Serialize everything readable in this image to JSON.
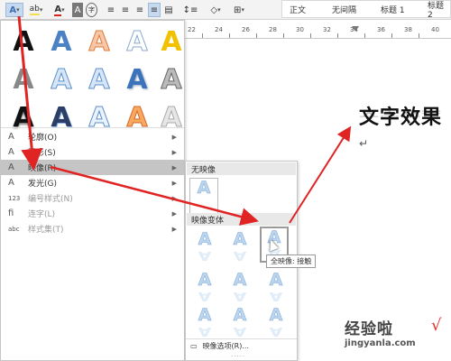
{
  "toolbar": {
    "text_effects_icon": "A",
    "highlight_icon": "ab",
    "font_color_icon": "A",
    "char_shading_icon": "A",
    "enclose_char_icon": "字"
  },
  "styles": [
    "正文",
    "无间隔",
    "标题 1",
    "标题 2"
  ],
  "ruler_numbers": [
    "22",
    "24",
    "26",
    "28",
    "30",
    "32",
    "34",
    "36",
    "38",
    "40"
  ],
  "document": {
    "wordart_text": "文字效果"
  },
  "gallery_letter": "A",
  "menu_items": [
    {
      "icon": "A",
      "label": "轮廓(O)",
      "disabled": false,
      "highlighted": false
    },
    {
      "icon": "A",
      "label": "阴影(S)",
      "disabled": false,
      "highlighted": false
    },
    {
      "icon": "A",
      "label": "映像(R)",
      "disabled": false,
      "highlighted": true
    },
    {
      "icon": "A",
      "label": "发光(G)",
      "disabled": false,
      "highlighted": false
    },
    {
      "icon": "123",
      "label": "编号样式(N)",
      "disabled": true,
      "highlighted": false
    },
    {
      "icon": "fi",
      "label": "连字(L)",
      "disabled": true,
      "highlighted": false
    },
    {
      "icon": "abc",
      "label": "样式集(T)",
      "disabled": true,
      "highlighted": false
    }
  ],
  "submenu": {
    "no_reflection_header": "无映像",
    "variants_header": "映像变体",
    "options_label": "映像选项(R)...",
    "more": "....."
  },
  "tooltip": "全映像: 接触",
  "watermark": {
    "title": "经验啦",
    "check": "√",
    "url": "jingyanla.com"
  },
  "colors": {
    "arrow": "#e02424",
    "highlight": "#c5c5c5",
    "reflection_fill": "#bcd6ef"
  }
}
